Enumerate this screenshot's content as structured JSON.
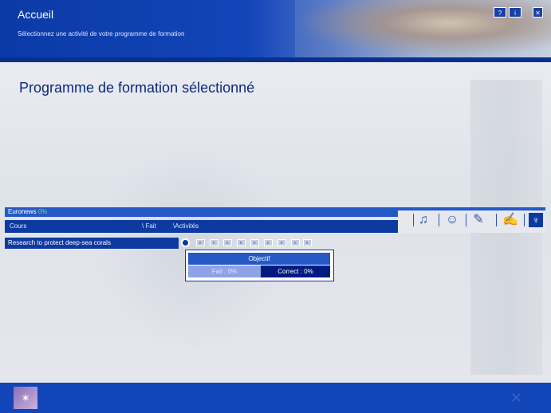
{
  "header": {
    "title": "Accueil",
    "subtitle": "Sélectionnez une activité de votre programme de formation",
    "help_button": "?",
    "info_button": "i",
    "close_button": "✕"
  },
  "page": {
    "title": "Programme de formation sélectionné"
  },
  "program": {
    "name": "Euronews",
    "progress": "0%",
    "columns": [
      "Cours",
      "Fait",
      "Activités"
    ],
    "rows": [
      {
        "label": "Research to protect deep-sea corals"
      }
    ]
  },
  "toolbar": {
    "icons": [
      "listen-icon",
      "speak-icon",
      "read-write-icon",
      "vocabulary-icon",
      "selected-icon"
    ]
  },
  "objective_popup": {
    "title": "Objectif",
    "done": "Fait : 0%",
    "correct": "Correct : 0%"
  },
  "footer": {
    "logo": "logo",
    "close": "✕"
  },
  "colors": {
    "brand_blue": "#1245b8",
    "dark_blue": "#0d3aa0",
    "progress_green": "#6ee06e"
  }
}
